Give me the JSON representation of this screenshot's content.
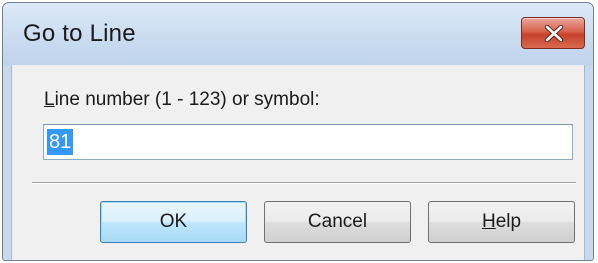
{
  "window": {
    "title": "Go to Line"
  },
  "prompt": {
    "label_access": "L",
    "label_rest": "ine number (1 - 123) or symbol:"
  },
  "line_input": {
    "value": "81"
  },
  "buttons": {
    "ok": "OK",
    "cancel": "Cancel",
    "help_access": "H",
    "help_rest": "elp"
  },
  "icons": {
    "close": "close-icon"
  },
  "colors": {
    "selection": "#3399ff",
    "close_button": "#c7402b",
    "default_button_border": "#3c7fb1"
  }
}
